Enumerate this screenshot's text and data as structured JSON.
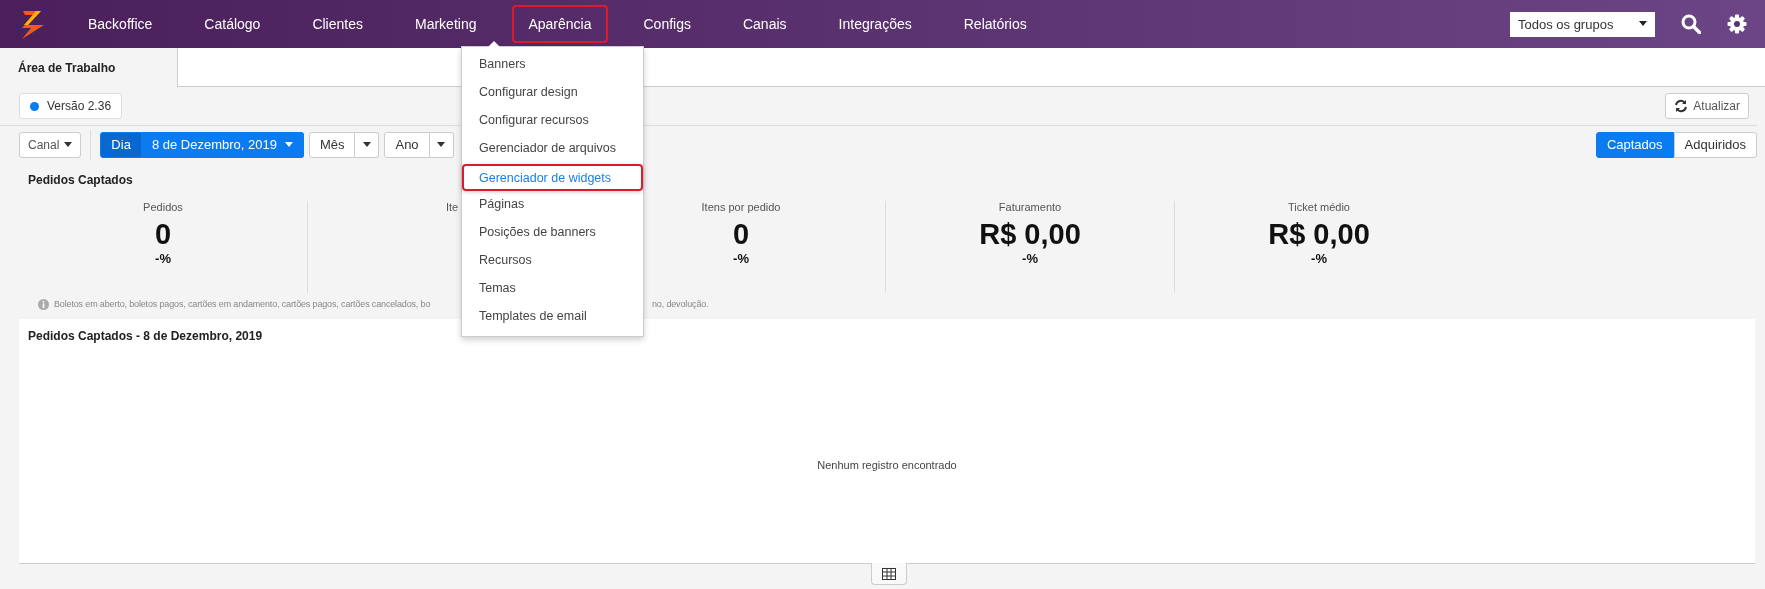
{
  "nav": {
    "items": [
      {
        "label": "Backoffice",
        "selected": false
      },
      {
        "label": "Catálogo",
        "selected": false
      },
      {
        "label": "Clientes",
        "selected": false
      },
      {
        "label": "Marketing",
        "selected": false
      },
      {
        "label": "Aparência",
        "selected": true
      },
      {
        "label": "Configs",
        "selected": false
      },
      {
        "label": "Canais",
        "selected": false
      },
      {
        "label": "Integrações",
        "selected": false
      },
      {
        "label": "Relatórios",
        "selected": false
      }
    ],
    "group_select": {
      "value": "Todos os grupos"
    }
  },
  "menu": {
    "items": [
      {
        "label": "Banners",
        "selected": false
      },
      {
        "label": "Configurar design",
        "selected": false
      },
      {
        "label": "Configurar recursos",
        "selected": false
      },
      {
        "label": "Gerenciador de arquivos",
        "selected": false
      },
      {
        "label": "Gerenciador de widgets",
        "selected": true
      },
      {
        "label": "Páginas",
        "selected": false
      },
      {
        "label": "Posições de banners",
        "selected": false
      },
      {
        "label": "Recursos",
        "selected": false
      },
      {
        "label": "Temas",
        "selected": false
      },
      {
        "label": "Templates de email",
        "selected": false
      }
    ]
  },
  "tabs": [
    {
      "label": "Área de Trabalho",
      "selected": true
    }
  ],
  "version": "Versão 2.36",
  "refresh_button": "Atualizar",
  "toolbar": {
    "channel": "Canal",
    "periods": [
      {
        "label": "Dia",
        "value": "8 de Dezembro, 2019",
        "selected": true
      },
      {
        "label": "Mês",
        "selected": false
      },
      {
        "label": "Ano",
        "selected": false
      }
    ]
  },
  "mode_toggle": [
    {
      "label": "Captados",
      "selected": true
    },
    {
      "label": "Adquiridos",
      "selected": false
    }
  ],
  "summary": {
    "title": "Pedidos Captados",
    "stats": [
      {
        "label": "Pedidos",
        "value": "0",
        "change": "-%"
      },
      {
        "label": "Ite"
      },
      {
        "label": "Itens por pedido",
        "value": "0",
        "change": "-%"
      },
      {
        "label": "Faturamento",
        "value": "R$ 0,00",
        "change": "-%"
      },
      {
        "label": "Ticket médio",
        "value": "R$ 0,00",
        "change": "-%"
      }
    ],
    "footnote": [
      "Boletos em aberto, boletos pagos, cartões em andamento, cartões pagos, cartões cancelados, bo",
      "no, devolução."
    ]
  },
  "chart_panel": {
    "title": "Pedidos Captados - 8 de Dezembro, 2019",
    "empty_message": "Nenhum registro encontrado"
  }
}
